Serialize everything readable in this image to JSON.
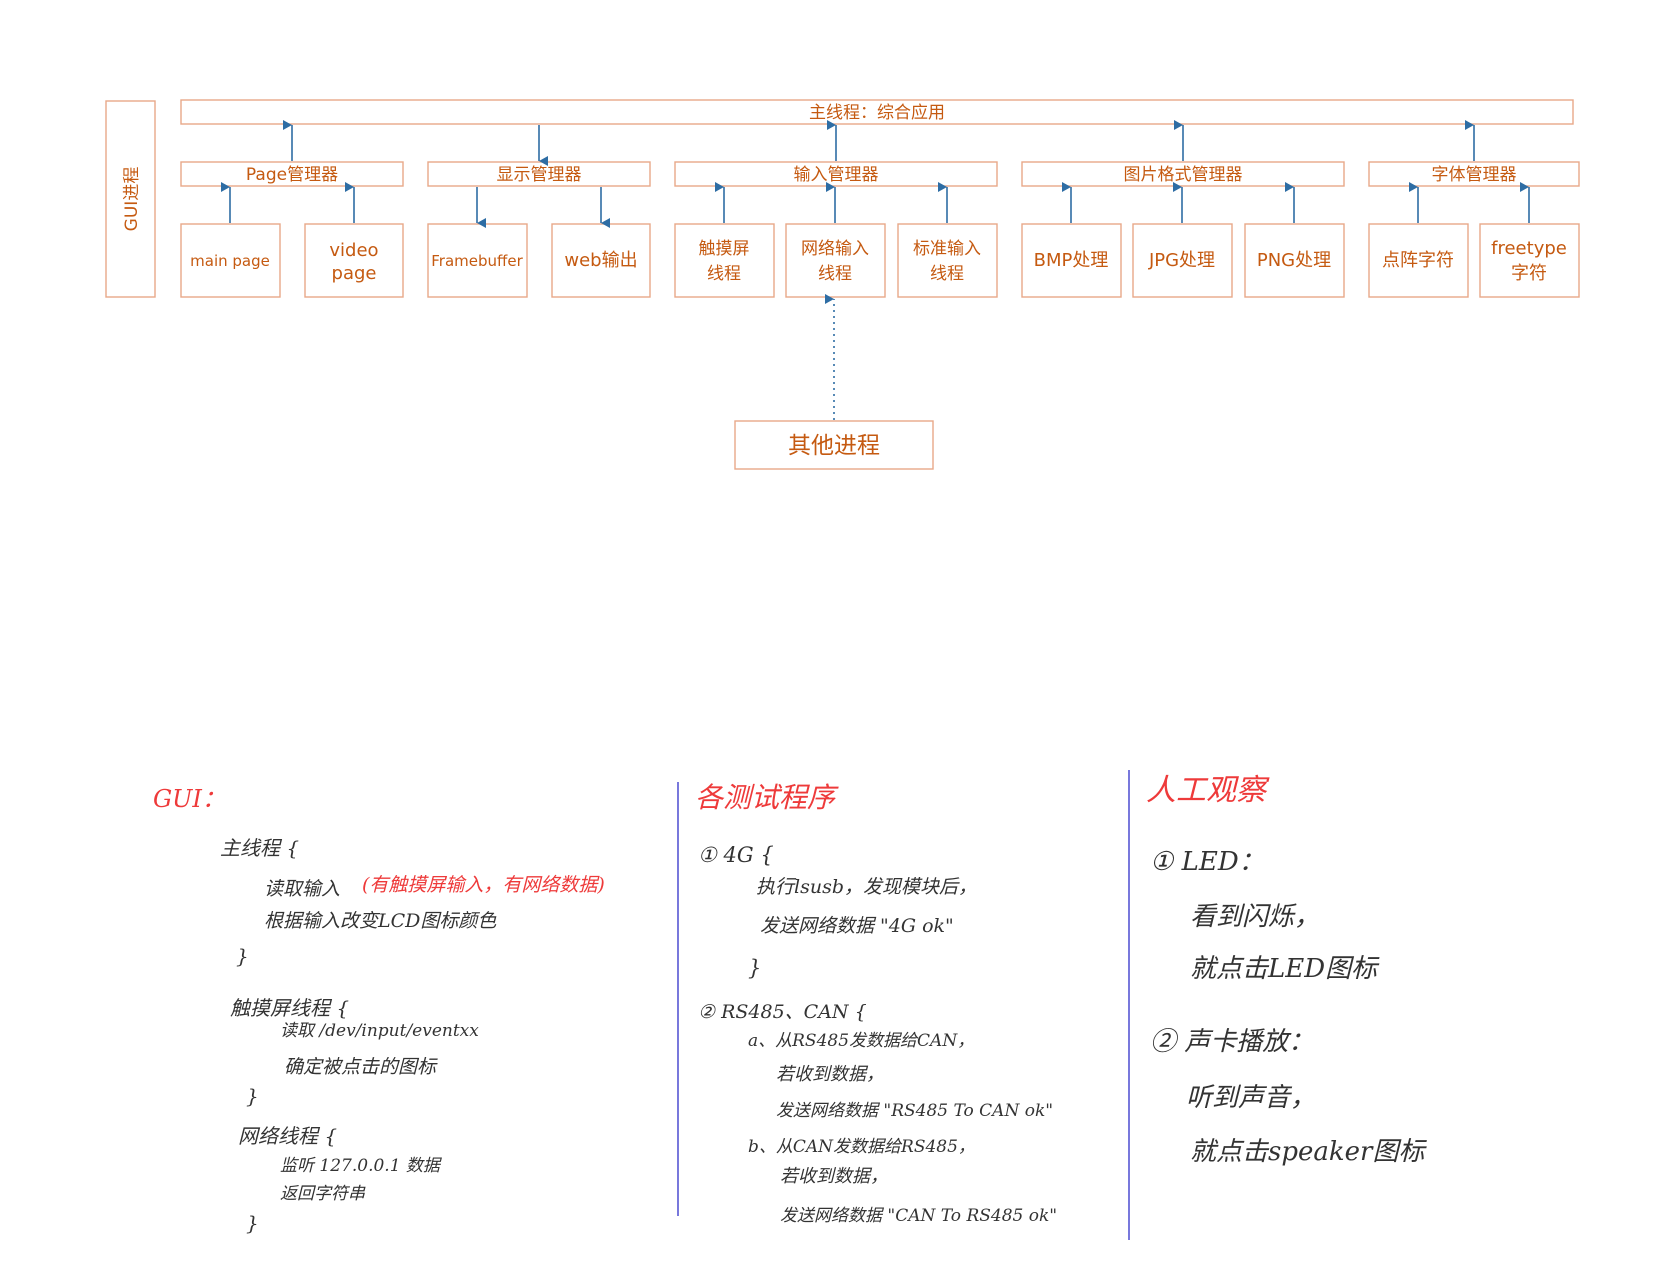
{
  "diagram": {
    "process_label": "GUI进程",
    "main_thread": "主线程：综合应用",
    "managers": {
      "page": "Page管理器",
      "display": "显示管理器",
      "input": "输入管理器",
      "image": "图片格式管理器",
      "font": "字体管理器"
    },
    "modules": {
      "main_page": "main  page",
      "video_page": [
        "video",
        "page"
      ],
      "framebuffer": "Framebuffer",
      "web": "web输出",
      "touch": [
        "触摸屏",
        "线程"
      ],
      "net_input": [
        "网络输入",
        "线程"
      ],
      "std_input": [
        "标准输入",
        "线程"
      ],
      "bmp": "BMP处理",
      "jpg": "JPG处理",
      "png": "PNG处理",
      "dot_font": "点阵字符",
      "freetype": [
        "freetype",
        "字符"
      ]
    },
    "other_process": "其他进程"
  },
  "notes": {
    "gui": {
      "title": "GUI：",
      "lines": [
        "主线程 {",
        "读取输入",
        "(有触摸屏输入，有网络数据)",
        "根据输入改变LCD图标颜色",
        "}",
        "触摸屏线程 {",
        "读取 /dev/input/eventxx",
        "确定被点击的图标",
        "}",
        "网络线程 {",
        "监听 127.0.0.1 数据",
        "返回字符串",
        "}"
      ]
    },
    "test": {
      "title": "各测试程序",
      "lines": [
        "① 4G {",
        "执行lsusb，发现模块后，",
        "发送网络数据 \"4G ok\"",
        "}",
        "② RS485、CAN {",
        "a、从RS485发数据给CAN，",
        "若收到数据，",
        "发送网络数据 \"RS485 To CAN ok\"",
        "b、从CAN发数据给RS485，",
        "若收到数据，",
        "发送网络数据 \"CAN To RS485 ok\""
      ]
    },
    "manual": {
      "title": "人工观察",
      "lines": [
        "① LED：",
        "看到闪烁，",
        "就点击LED图标",
        "② 声卡播放：",
        "听到声音，",
        "就点击speaker图标"
      ]
    }
  },
  "colors": {
    "box_border": "#e8a888",
    "box_text": "#c55a11",
    "arrow": "#2e6da4",
    "note_red": "#ee3a3a",
    "note_black": "#333333",
    "divider": "#6a6ad8"
  }
}
